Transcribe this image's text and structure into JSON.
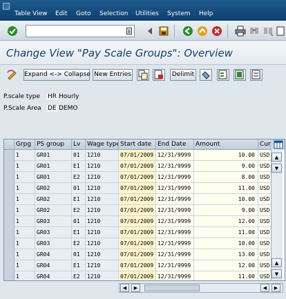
{
  "menu": [
    "Table View",
    "Edit",
    "Goto",
    "Selection",
    "Utilities",
    "System",
    "Help"
  ],
  "toolbar": {
    "command_value": ""
  },
  "title": "Change View \"Pay Scale Groups\": Overview",
  "app_toolbar": {
    "expand_collapse": "Expand <-> Collapse",
    "new_entries": "New Entries",
    "delimit": "Delimit"
  },
  "fields": {
    "ps_type": {
      "label": "P.scale type",
      "code": "HR",
      "desc": "Hourly"
    },
    "ps_area": {
      "label": "P.Scale Area",
      "code": "DE",
      "desc": "DEMO"
    }
  },
  "table": {
    "columns": [
      "Grpg",
      "PS group",
      "Lv",
      "Wage type",
      "Start date",
      "End Date",
      "Amount",
      "Curr"
    ],
    "rows": [
      [
        "1",
        "GR01",
        "01",
        "1210",
        "07/01/2009",
        "12/31/9999",
        "10.00",
        "USD"
      ],
      [
        "1",
        "GR01",
        "E1",
        "1210",
        "07/01/2009",
        "12/31/9999",
        "9.00",
        "USD"
      ],
      [
        "1",
        "GR01",
        "E2",
        "1210",
        "07/01/2009",
        "12/31/9999",
        "8.00",
        "USD"
      ],
      [
        "1",
        "GR02",
        "01",
        "1210",
        "07/01/2009",
        "12/31/9999",
        "11.00",
        "USD"
      ],
      [
        "1",
        "GR02",
        "E1",
        "1210",
        "07/01/2009",
        "12/31/9999",
        "10.00",
        "USD"
      ],
      [
        "1",
        "GR02",
        "E2",
        "1210",
        "07/01/2009",
        "12/31/9999",
        "9.00",
        "USD"
      ],
      [
        "1",
        "GR03",
        "01",
        "1210",
        "07/01/2009",
        "12/31/9999",
        "12.00",
        "USD"
      ],
      [
        "1",
        "GR03",
        "E1",
        "1210",
        "07/01/2009",
        "12/31/9999",
        "11.00",
        "USD"
      ],
      [
        "1",
        "GR03",
        "E2",
        "1210",
        "07/01/2009",
        "12/31/9999",
        "10.00",
        "USD"
      ],
      [
        "1",
        "GR04",
        "01",
        "1210",
        "07/01/2009",
        "12/31/9999",
        "13.00",
        "USD"
      ],
      [
        "1",
        "GR04",
        "E1",
        "1210",
        "07/01/2009",
        "12/31/9999",
        "12.00",
        "USD"
      ],
      [
        "1",
        "GR04",
        "E2",
        "1210",
        "07/01/2009",
        "12/31/9999",
        "11.00",
        "USD"
      ]
    ]
  },
  "colors": {
    "menubar": "#0e3f6f",
    "title": "#163f6a",
    "enter_green": "#2e8b2e",
    "cancel_red": "#c62828"
  }
}
